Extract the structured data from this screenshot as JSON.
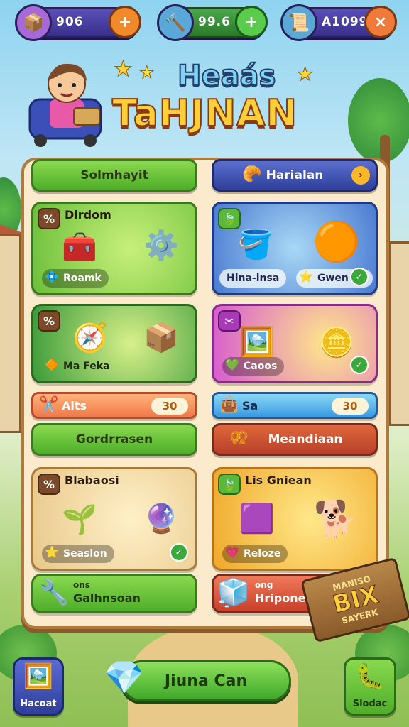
{
  "resources": [
    {
      "value": "906",
      "icon": "crate-icon",
      "action": "+"
    },
    {
      "value": "99.6",
      "icon": "hammer-icon",
      "action": "+"
    },
    {
      "value": "A1099",
      "icon": "scroll-icon",
      "action": "×"
    }
  ],
  "title": {
    "line1": "Heaás",
    "line2": "TaHJNAN"
  },
  "tabs": {
    "left": "Solmhayit",
    "right": "Harialan"
  },
  "cards": [
    {
      "tag": "%",
      "title": "Dirdom",
      "label": "Roamk"
    },
    {
      "label": "Hina-insa",
      "label2": "Gwen"
    },
    {
      "tag": "%",
      "label": "Ma Feka"
    },
    {
      "label": "Caoos"
    }
  ],
  "bars": [
    {
      "label": "Alts",
      "value": "30"
    },
    {
      "label": "Sa",
      "value": "30"
    }
  ],
  "sections": {
    "left": "Gordrrasen",
    "right": "Meandiaan"
  },
  "cards2": [
    {
      "tag": "%",
      "title": "Blabaosi",
      "label": "Seaslon"
    },
    {
      "title": "Lis Gniean",
      "label": "Reloze"
    }
  ],
  "footer_cards": [
    {
      "line1": "ons",
      "line2": "Galhnsoan"
    },
    {
      "line1": "ong",
      "line2": "Hriponen"
    }
  ],
  "sign": {
    "big": "BIX",
    "top": "MANISO",
    "bottom": "SAYERK"
  },
  "bottom": {
    "left": "Hacoat",
    "play": "Jiuna Can",
    "right": "Slodac"
  },
  "colors": {
    "accent": "#4fae2a",
    "panel": "#fbeacc",
    "gold": "#ffcf3a"
  }
}
